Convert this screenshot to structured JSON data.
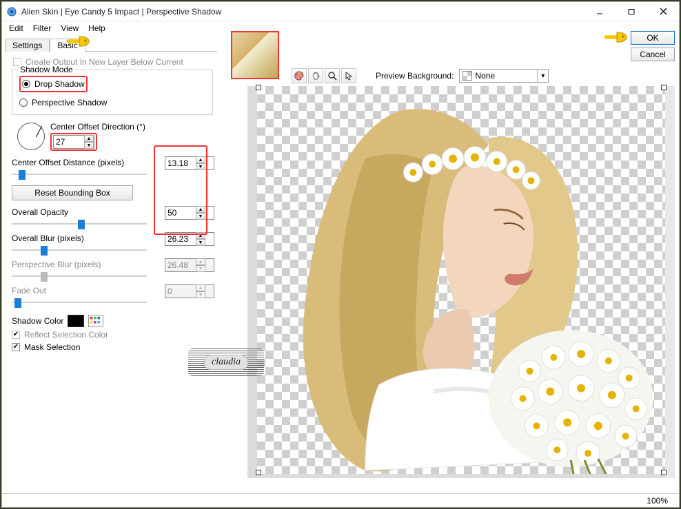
{
  "window": {
    "title": "Alien Skin | Eye Candy 5 Impact | Perspective Shadow"
  },
  "menu": {
    "edit": "Edit",
    "filter": "Filter",
    "view": "View",
    "help": "Help"
  },
  "tabs": {
    "settings": "Settings",
    "basic": "Basic"
  },
  "check_create_output": "Create Output In New Layer Below Current",
  "shadow_mode": {
    "legend": "Shadow Mode",
    "drop": "Drop Shadow",
    "perspective": "Perspective Shadow",
    "selected": "drop"
  },
  "direction": {
    "label": "Center Offset Direction (°)",
    "value": "27"
  },
  "distance": {
    "label": "Center Offset Distance (pixels)",
    "value": "13.18"
  },
  "reset_bbox": "Reset Bounding Box",
  "opacity": {
    "label": "Overall Opacity",
    "value": "50"
  },
  "blur": {
    "label": "Overall Blur (pixels)",
    "value": "26.23"
  },
  "pers_blur": {
    "label": "Perspective Blur (pixels)",
    "value": "26.48"
  },
  "fade": {
    "label": "Fade Out",
    "value": "0"
  },
  "shadow_color_label": "Shadow Color",
  "reflect": "Reflect Selection Color",
  "mask": "Mask Selection",
  "preview_bg": {
    "label": "Preview Background:",
    "value": "None"
  },
  "buttons": {
    "ok": "OK",
    "cancel": "Cancel"
  },
  "status": {
    "zoom": "100%"
  },
  "watermark": "claudia"
}
